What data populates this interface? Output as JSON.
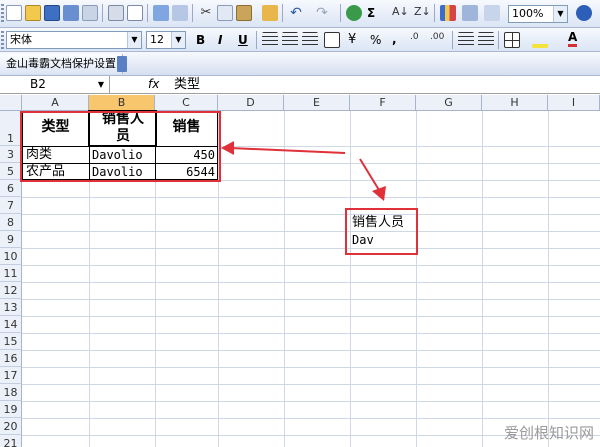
{
  "toolbar": {
    "zoom": "100%",
    "font_name": "宋体",
    "font_size": "12",
    "bold": "B",
    "italic": "I",
    "underline": "U",
    "percent": "%",
    "comma": ",",
    "sigma": "Σ",
    "font_color_label": "A"
  },
  "plugin_bar": {
    "title": "金山毒霸文档保护设置"
  },
  "formula_bar": {
    "name_box": "B2",
    "fx": "fx",
    "value": "类型"
  },
  "columns": [
    "A",
    "B",
    "C",
    "D",
    "E",
    "F",
    "G",
    "H",
    "I"
  ],
  "rows": [
    "1",
    "3",
    "5",
    "6",
    "7",
    "8",
    "9",
    "10",
    "11",
    "12",
    "13",
    "14",
    "15",
    "16",
    "17",
    "18",
    "19",
    "20",
    "21"
  ],
  "table": {
    "headers": [
      "类型",
      "销售人员",
      "销售"
    ],
    "rows": [
      {
        "type": "肉类",
        "person": "Davolio",
        "sales": "450"
      },
      {
        "type": "农产品",
        "person": "Davolio",
        "sales": "6544"
      }
    ]
  },
  "callout": {
    "line1": "销售人员",
    "line2": "Dav"
  },
  "watermark": "爱创根知识网",
  "colors": {
    "accent_red": "#e0303a",
    "selected_col": "#f8c66c"
  }
}
